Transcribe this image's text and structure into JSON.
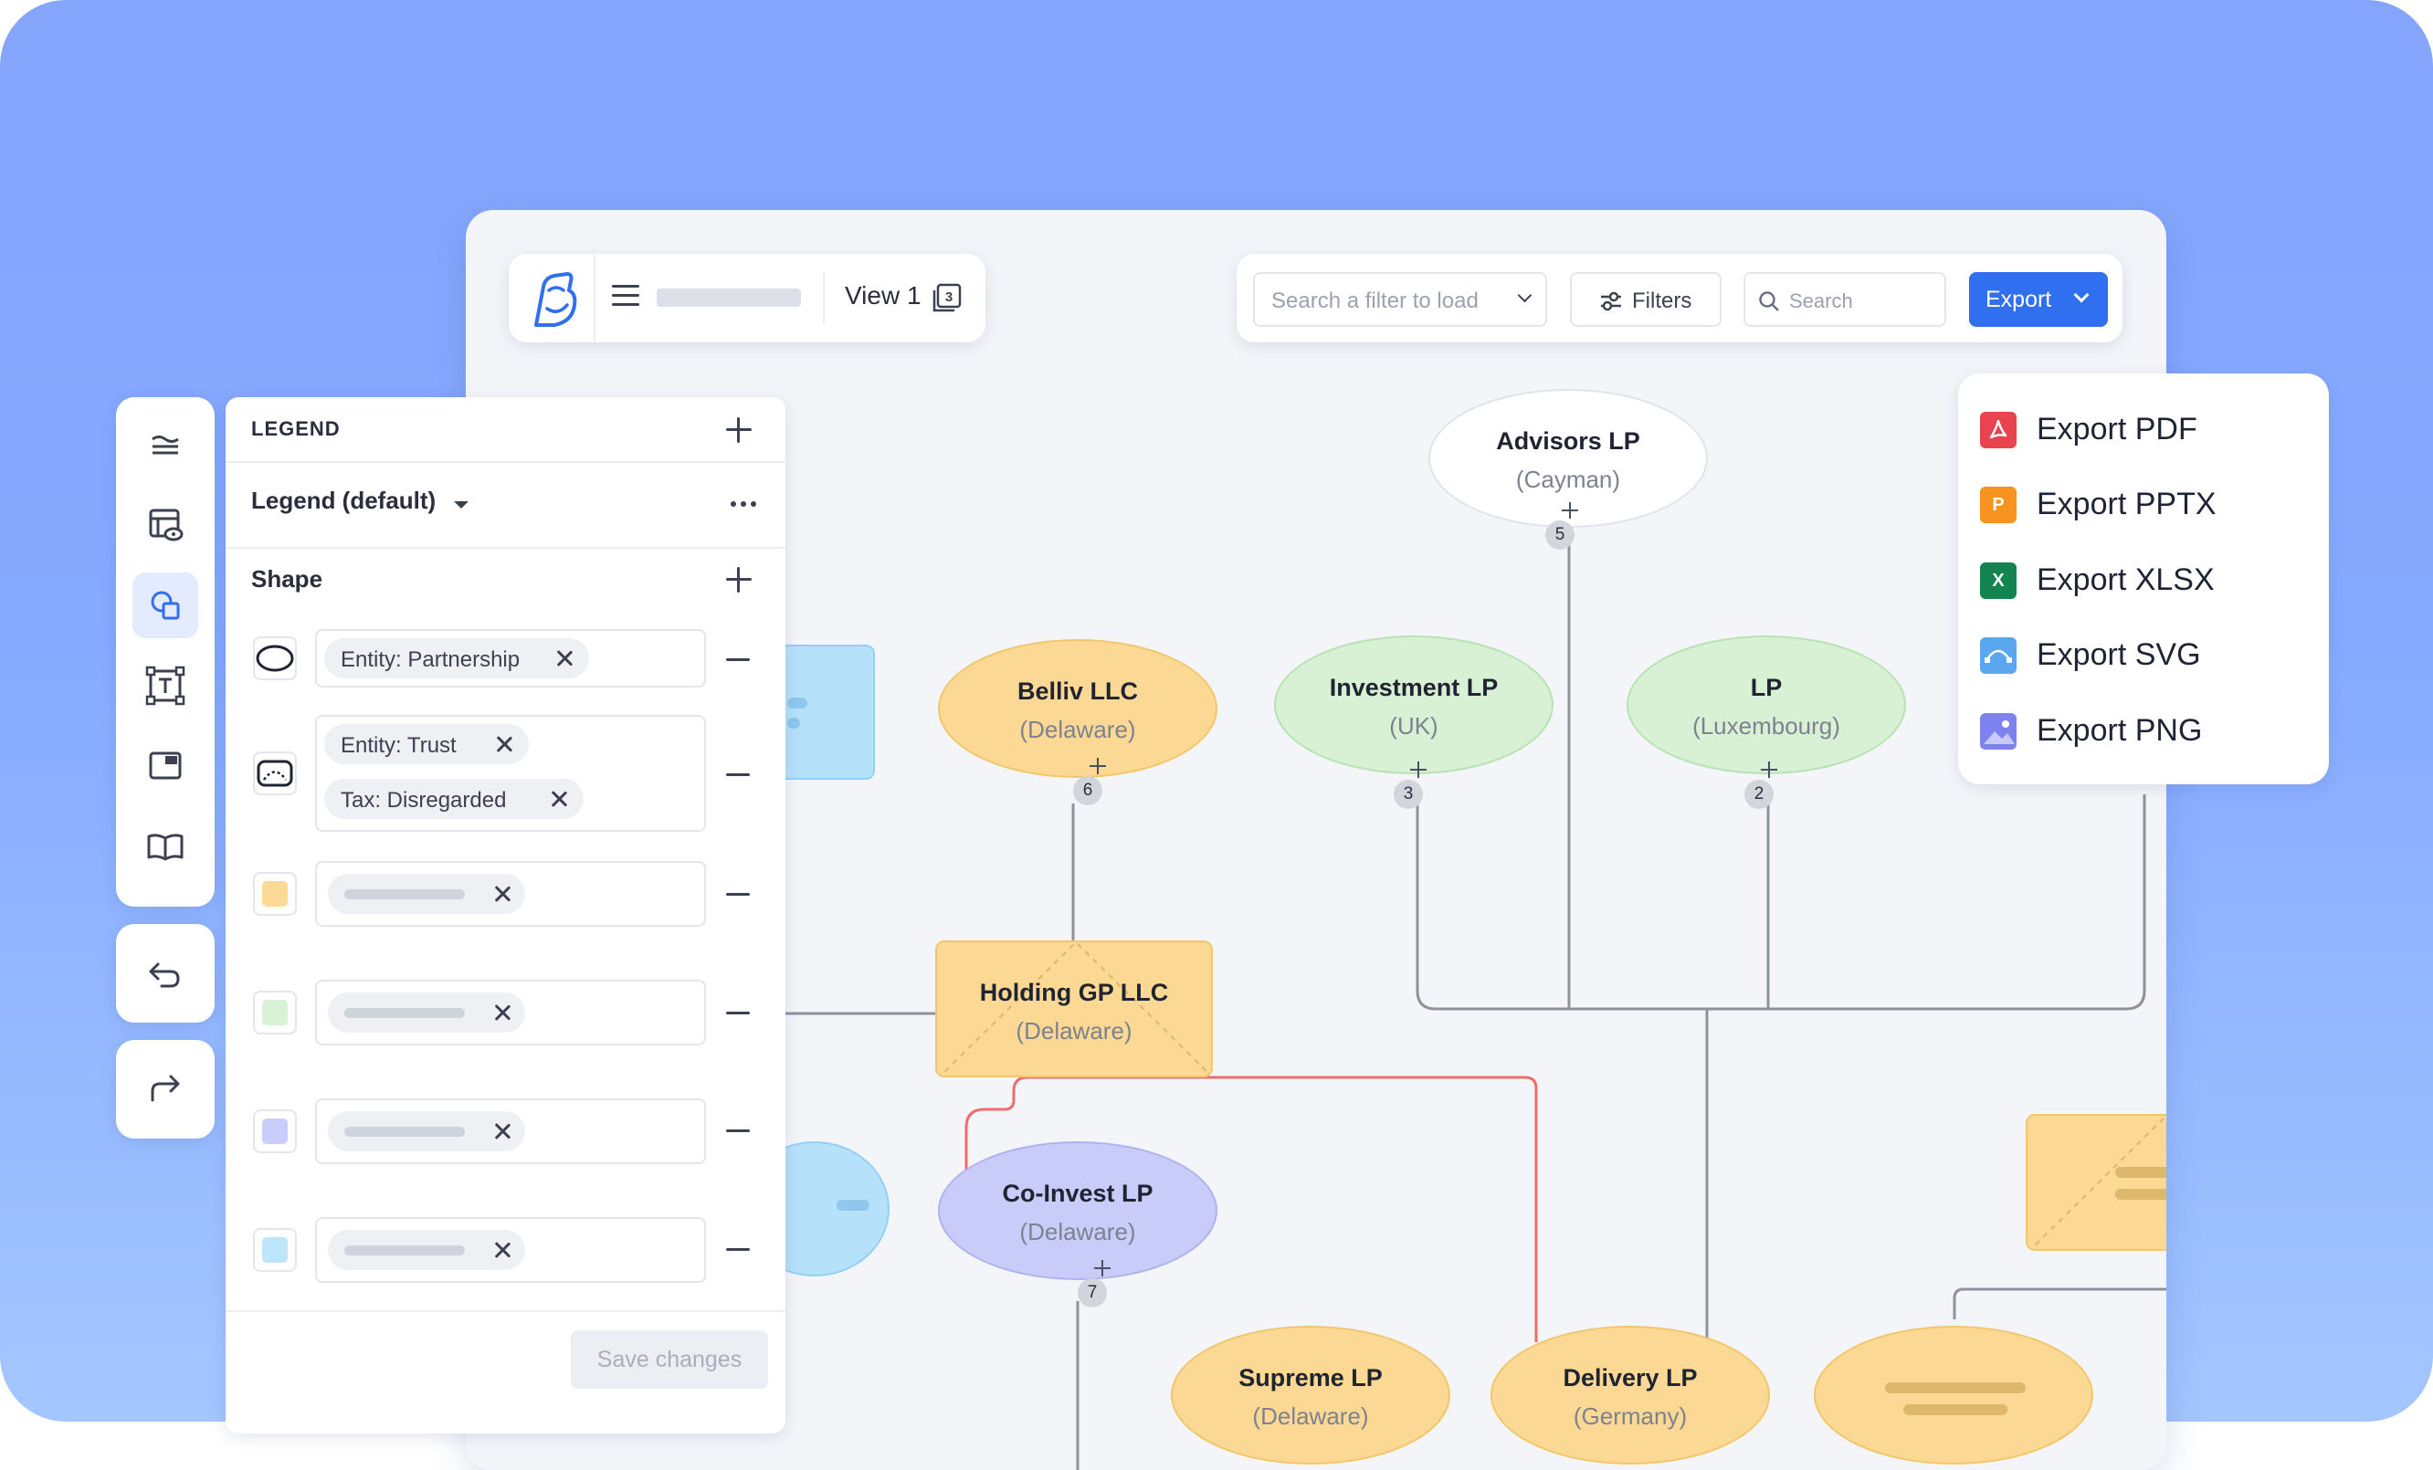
{
  "header": {
    "view_label": "View 1",
    "filter_placeholder": "Search a filter to load",
    "filters_label": "Filters",
    "search_placeholder": "Search",
    "export_label": "Export"
  },
  "export_menu": {
    "items": [
      {
        "label": "Export PDF",
        "icon": "pdf-icon",
        "color": "#e8434f"
      },
      {
        "label": "Export PPTX",
        "icon": "pptx-icon",
        "glyph": "P",
        "color": "#f7931e"
      },
      {
        "label": "Export XLSX",
        "icon": "xlsx-icon",
        "glyph": "X",
        "color": "#13834f"
      },
      {
        "label": "Export SVG",
        "icon": "svg-icon",
        "color": "#5aa7f0"
      },
      {
        "label": "Export PNG",
        "icon": "png-icon",
        "color": "#7d82ef"
      }
    ]
  },
  "toolbar": {
    "items": [
      "layers-icon",
      "view-icon",
      "shapes-icon",
      "text-box-icon",
      "frame-icon",
      "book-icon"
    ],
    "active": "shapes-icon",
    "undo_icon": "undo-icon",
    "redo_icon": "redo-icon"
  },
  "legend": {
    "title": "LEGEND",
    "selected": "Legend (default)",
    "section_title": "Shape",
    "rows": [
      {
        "swatch": "ellipse",
        "tags": [
          "Entity: Partnership"
        ]
      },
      {
        "swatch": "trust-shape",
        "tags": [
          "Entity: Trust",
          "Tax: Disregarded"
        ]
      },
      {
        "swatch": "color",
        "color": "#fcd995"
      },
      {
        "swatch": "color",
        "color": "#d8f2d6"
      },
      {
        "swatch": "color",
        "color": "#c9cdfb"
      },
      {
        "swatch": "color",
        "color": "#bde6fb"
      }
    ],
    "save_label": "Save changes"
  },
  "colors": {
    "accent": "#2f6ff0",
    "orange_node": "#fbd894",
    "green_node": "#d8f0d4",
    "purple_node": "#c9ccf8",
    "blue_node": "#b5e1fb",
    "connector": "#8e929d",
    "red_connector": "#ee6e6e"
  },
  "nodes": [
    {
      "id": "advisors",
      "name": "Advisors LP",
      "sub": "(Cayman)",
      "badge": "5"
    },
    {
      "id": "belliv",
      "name": "Belliv LLC",
      "sub": "(Delaware)",
      "badge": "6"
    },
    {
      "id": "investment",
      "name": "Investment LP",
      "sub": "(UK)",
      "badge": "3"
    },
    {
      "id": "lp",
      "name": "LP",
      "sub": "(Luxembourg)",
      "badge": "2"
    },
    {
      "id": "holding",
      "name": "Holding GP LLC",
      "sub": "(Delaware)"
    },
    {
      "id": "coinvest",
      "name": "Co-Invest LP",
      "sub": "(Delaware)",
      "badge": "7"
    },
    {
      "id": "supreme",
      "name": "Supreme LP",
      "sub": "(Delaware)"
    },
    {
      "id": "delivery",
      "name": "Delivery LP",
      "sub": "(Germany)"
    }
  ]
}
